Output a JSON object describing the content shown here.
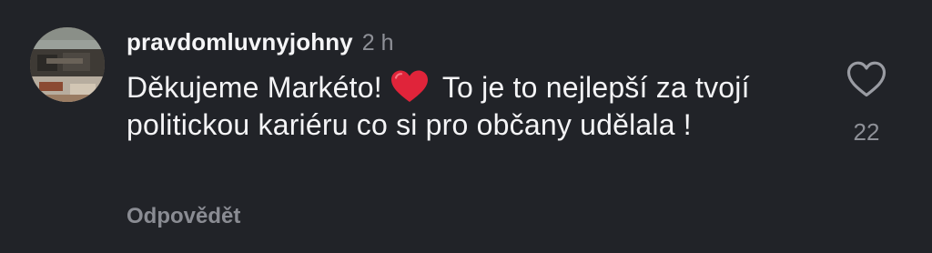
{
  "comment": {
    "username": "pravdomluvnyjohny",
    "time": "2 h",
    "text_before_emoji": "Děkujeme Markéto!",
    "emoji": "red-heart-emoji",
    "text_after_emoji": "To je to nejlepší za tvojí politickou kariéru co si pro občany udělala !",
    "reply_label": "Odpovědět",
    "like_count": "22"
  },
  "colors": {
    "background": "#212328",
    "primary_text": "#f4f4f6",
    "secondary_text": "#8e9097",
    "heart_emoji": "#e0243a"
  },
  "icons": {
    "like": "heart-outline-icon",
    "avatar": "user-avatar-photo"
  }
}
